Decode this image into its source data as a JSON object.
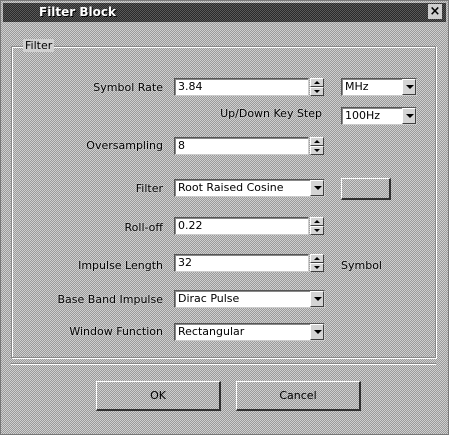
{
  "window": {
    "title": "Filter Block",
    "close_label": "×"
  },
  "group": {
    "label": "Filter"
  },
  "fields": {
    "symbol_rate": {
      "label": "Symbol Rate",
      "value": "3.84",
      "unit": "MHz"
    },
    "key_step": {
      "label": "Up/Down Key Step",
      "value": "100Hz"
    },
    "oversampling": {
      "label": "Oversampling",
      "value": "8"
    },
    "filter": {
      "label": "Filter",
      "value": "Root Raised Cosine"
    },
    "rolloff": {
      "label": "Roll-off",
      "value": "0.22"
    },
    "impulse_length": {
      "label": "Impulse Length",
      "value": "32",
      "unit": "Symbol"
    },
    "base_band_impulse": {
      "label": "Base Band Impulse",
      "value": "Dirac Pulse"
    },
    "window_function": {
      "label": "Window Function",
      "value": "Rectangular"
    }
  },
  "buttons": {
    "ok": "OK",
    "cancel": "Cancel"
  }
}
